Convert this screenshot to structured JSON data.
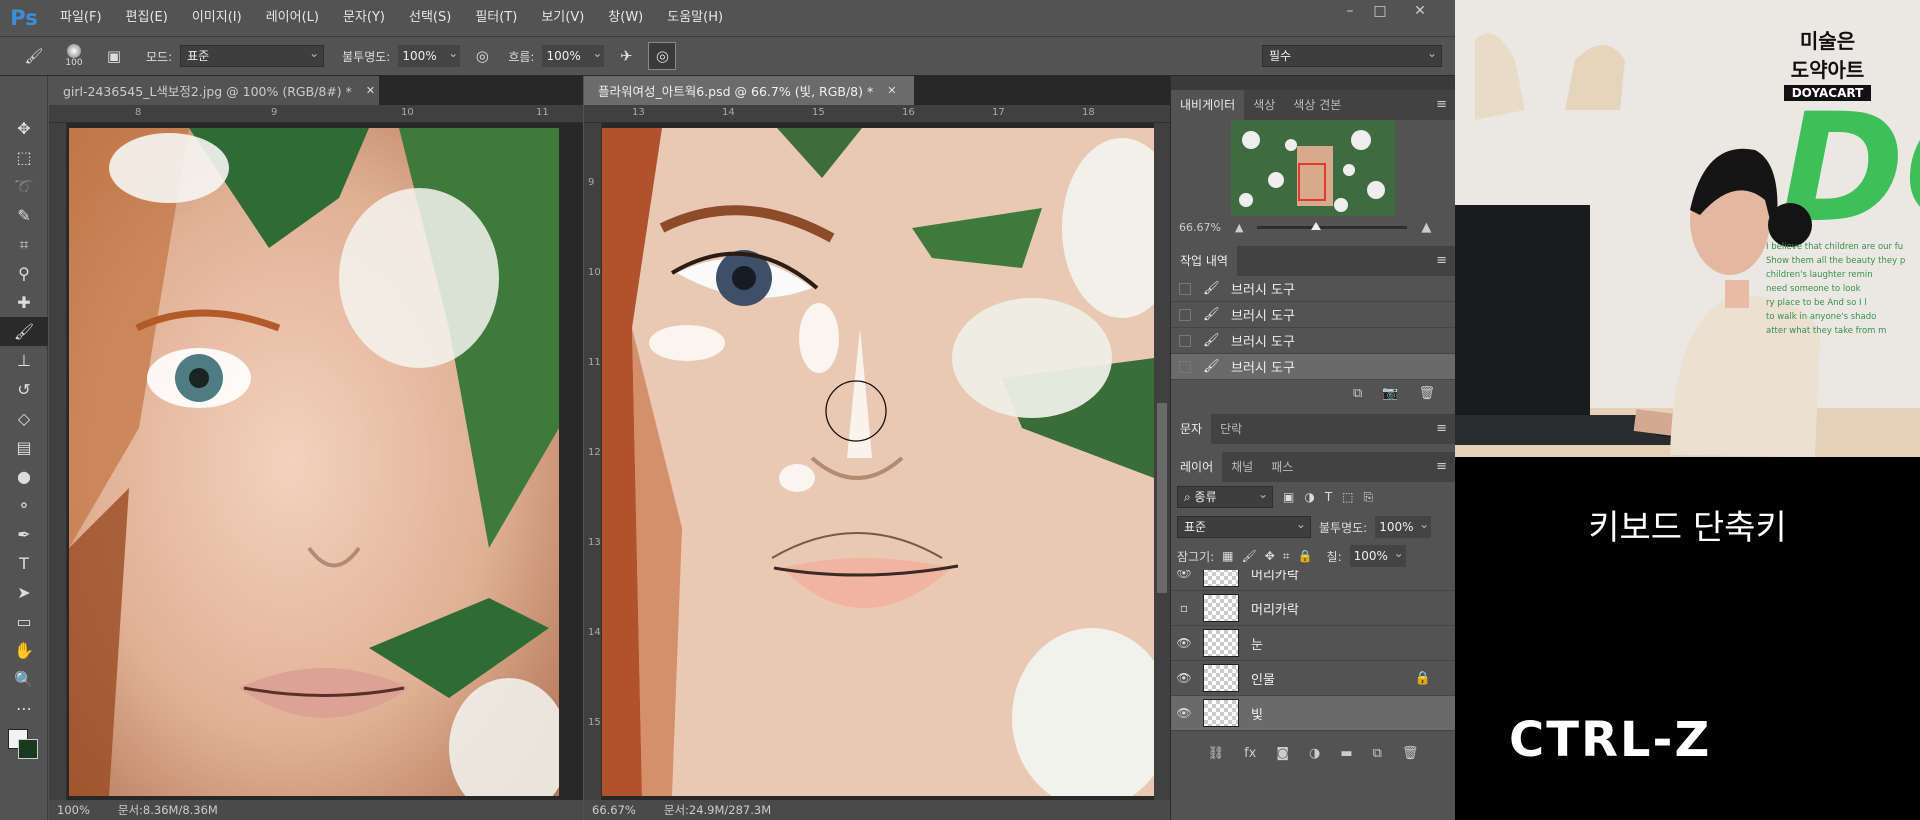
{
  "app": {
    "logo": "Ps"
  },
  "menu": [
    "파일(F)",
    "편집(E)",
    "이미지(I)",
    "레이어(L)",
    "문자(Y)",
    "선택(S)",
    "필터(T)",
    "보기(V)",
    "창(W)",
    "도움말(H)"
  ],
  "options": {
    "brush_size": "100",
    "mode_label": "모드:",
    "mode_value": "표준",
    "opacity_label": "불투명도:",
    "opacity_value": "100%",
    "flow_label": "흐름:",
    "flow_value": "100%",
    "workspace": "필수"
  },
  "documents": [
    {
      "tab": "girl-2436545_L색보정2.jpg @ 100% (RGB/8#) *",
      "zoom": "100%",
      "doc_size": "문서:8.36M/8.36M",
      "ruler": [
        "8",
        "9",
        "10",
        "11"
      ]
    },
    {
      "tab": "플라워여성_아트웍6.psd @ 66.7% (빛, RGB/8) *",
      "zoom": "66.67%",
      "doc_size": "문서:24.9M/287.3M",
      "ruler": [
        "13",
        "14",
        "15",
        "16",
        "17",
        "18"
      ],
      "vruler": [
        "9",
        "10",
        "11",
        "12",
        "13",
        "14",
        "15"
      ]
    }
  ],
  "navigator": {
    "tabs": [
      "내비게이터",
      "색상",
      "색상 견본"
    ],
    "zoom": "66.67%"
  },
  "history": {
    "tabs": [
      "작업 내역"
    ],
    "items": [
      "브러시 도구",
      "브러시 도구",
      "브러시 도구",
      "브러시 도구"
    ]
  },
  "char_tabs": [
    "문자",
    "단락"
  ],
  "layers": {
    "tabs": [
      "레이어",
      "채널",
      "패스"
    ],
    "filter": "종류",
    "blend": "표준",
    "opacity_label": "불투명도:",
    "opacity": "100%",
    "lock_label": "잠그기:",
    "fill_label": "칠:",
    "fill": "100%",
    "items": [
      {
        "name": "머리카락",
        "visible": true
      },
      {
        "name": "머리카락",
        "visible": false
      },
      {
        "name": "눈",
        "visible": true
      },
      {
        "name": "인물",
        "visible": true,
        "locked": true
      },
      {
        "name": "빛",
        "visible": true,
        "selected": true
      }
    ]
  },
  "overlay": {
    "brand_top": "미술은",
    "brand_mid": "도약아트",
    "brand_en": "DOYACART",
    "title": "키보드 단축키",
    "shortcut": "CTRL-Z"
  },
  "poster_text": [
    "I believe that children are our fu",
    "Show them all the beauty they p",
    "children's laughter remin",
    "need someone to look",
    "ry place to be And so I l",
    "to walk in anyone's shado",
    "atter what they take from m"
  ],
  "colors": {
    "accent": "#3a8fd8",
    "panel_bg": "#535353",
    "dark_bg": "#282828",
    "poster_green": "#3fbf5a"
  }
}
